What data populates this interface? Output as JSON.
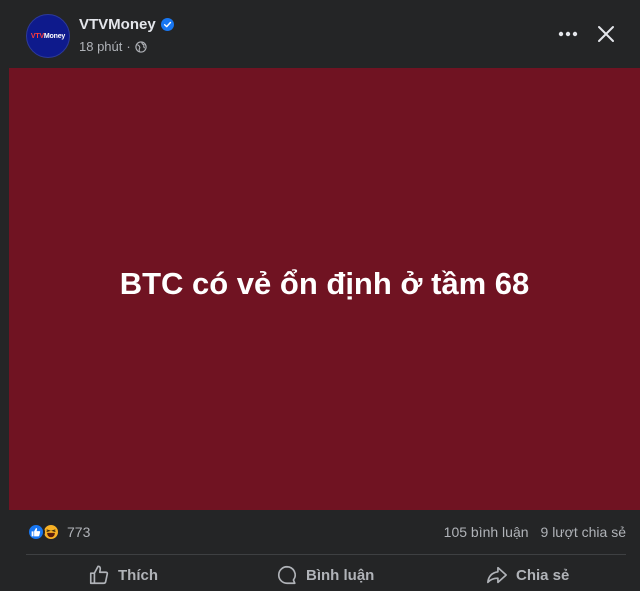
{
  "post": {
    "page_name": "VTVMoney",
    "avatar_text_vtv": "VTV",
    "avatar_text_money": "Money",
    "timestamp": "18 phút",
    "verified_icon": "verified-badge-icon",
    "privacy_icon": "globe-icon",
    "media_text": "BTC có vẻ ổn định ở tầm 68",
    "media_background": "#701322"
  },
  "stats": {
    "reaction_icons": [
      "like-icon",
      "haha-icon"
    ],
    "reaction_count": "773",
    "comments": "105 bình luận",
    "shares": "9 lượt chia sẻ"
  },
  "actions": {
    "like_label": "Thích",
    "comment_label": "Bình luận",
    "share_label": "Chia sẻ"
  },
  "colors": {
    "background": "#242526",
    "accent": "#1877f2",
    "secondary_text": "#b0b3b8"
  }
}
